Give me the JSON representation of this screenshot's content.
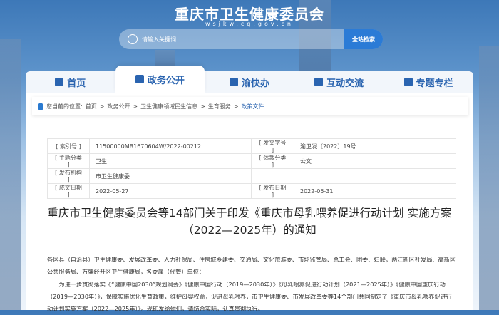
{
  "header": {
    "site_title": "重庆市卫生健康委员会",
    "domain": "wsjkw.cq.gov.cn",
    "search_placeholder": "请输入关键词",
    "search_button": "全站检索"
  },
  "nav": [
    {
      "label": "首页",
      "icon": "home-icon"
    },
    {
      "label": "政务公开",
      "icon": "bank-icon",
      "active": true
    },
    {
      "label": "渝快办",
      "icon": "document-icon"
    },
    {
      "label": "互动交流",
      "icon": "chat-icon"
    },
    {
      "label": "专题专栏",
      "icon": "grid-icon"
    }
  ],
  "breadcrumb": {
    "prefix": "您当前的位置:",
    "items": [
      "首页",
      "政务公开",
      "卫生健康领域民生信息",
      "生育服务",
      "政策文件"
    ],
    "sep": ">"
  },
  "meta": [
    {
      "l1": "[ 索引号 ]",
      "v1": "11500000MB1670604W/2022-00212",
      "l2": "[ 发文字号 ]",
      "v2": "渝卫发〔2022〕19号"
    },
    {
      "l1": "[ 主题分类 ]",
      "v1": "卫生",
      "l2": "[ 体裁分类 ]",
      "v2": "公文"
    },
    {
      "l1": "[ 发布机构 ]",
      "v1": "市卫生健康委",
      "l2": "",
      "v2": ""
    },
    {
      "l1": "[ 成文日期 ]",
      "v1": "2022-05-27",
      "l2": "[ 发布日期 ]",
      "v2": "2022-05-31"
    }
  ],
  "title": {
    "line1": "重庆市卫生健康委员会等14部门关于印发《重庆市母乳喂养促进行动计划 实施方案",
    "line2": "（2022—2025年）的通知"
  },
  "body": {
    "p1": "各区县（自治县）卫生健康委、发展改革委、人力社保局、住房城乡建委、交通局、文化旅游委、市场监管局、总工会、团委、妇联，两江新区社发局、高新区公共服务局、万盛经开区卫生健康局，各委属（代管）单位：",
    "p2": "为进一步贯彻落实《“健康中国2030”规划纲要》《健康中国行动（2019—2030年）》《母乳喂养促进行动计划（2021—2025年）》《健康中国重庆行动（2019—2030年）》，保障实施优化生育政策，维护母婴权益，促进母乳喂养，市卫生健康委、市发展改革委等14个部门共同制定了《重庆市母乳喂养促进行动计划实施方案（2022—2025年）》。现印发给你们，请结合实际，认真贯彻执行。"
  }
}
